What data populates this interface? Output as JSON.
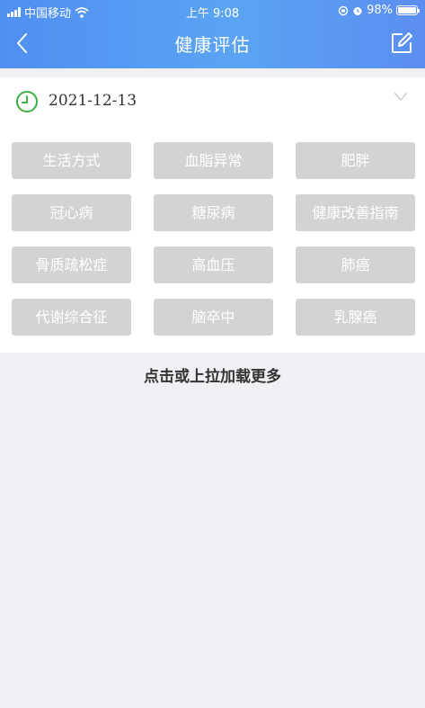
{
  "status_bar": {
    "carrier": "中国移动",
    "time": "上午 9:08",
    "battery": "98%",
    "battery_level": 0.98
  },
  "nav": {
    "title": "健康评估",
    "back_icon": "chevron-left-icon",
    "edit_icon": "edit-icon"
  },
  "filter": {
    "date": "2021-12-13"
  },
  "tags": [
    "生活方式",
    "血脂异常",
    "肥胖",
    "冠心病",
    "糖尿病",
    "健康改善指南",
    "骨质疏松症",
    "高血压",
    "肺癌",
    "代谢综合征",
    "脑卒中",
    "乳腺癌"
  ],
  "footer": {
    "load_more": "点击或上拉加载更多"
  },
  "colors": {
    "header_start": "#4f8ff2",
    "header_end": "#5b8ef0",
    "tag_bg": "#d3d3d3",
    "page_bg": "#f0f0f4",
    "clock_green": "#3cb043"
  }
}
